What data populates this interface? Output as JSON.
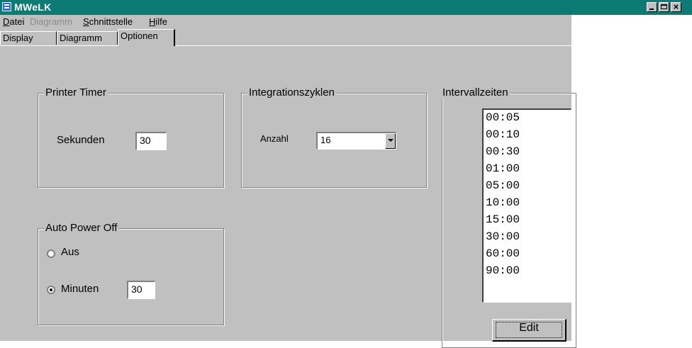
{
  "window": {
    "title": "MWeLK"
  },
  "menu": [
    {
      "label": "Datei",
      "accel": "D",
      "rest": "atei",
      "disabled": false
    },
    {
      "label": "Diagramm",
      "accel": "",
      "rest": "Diagramm",
      "disabled": true
    },
    {
      "label": "Schnittstelle",
      "accel": "S",
      "rest": "chnittstelle",
      "disabled": false
    },
    {
      "label": "Hilfe",
      "accel": "H",
      "rest": "ilfe",
      "disabled": false
    }
  ],
  "tabs": [
    {
      "label": "Display",
      "active": false
    },
    {
      "label": "Diagramm",
      "active": false
    },
    {
      "label": "Optionen",
      "active": true
    }
  ],
  "printer_timer": {
    "title": "Printer Timer",
    "label": "Sekunden",
    "value": "30"
  },
  "integration": {
    "title": "Integrationszyklen",
    "label": "Anzahl",
    "value": "16"
  },
  "auto_power_off": {
    "title": "Auto Power Off",
    "option_off": "Aus",
    "option_minutes": "Minuten",
    "selected": "Minuten",
    "minutes_value": "30"
  },
  "intervals": {
    "title": "Intervallzeiten",
    "items": [
      "00:05",
      "00:10",
      "00:30",
      "01:00",
      "05:00",
      "10:00",
      "15:00",
      "30:00",
      "60:00",
      "90:00"
    ],
    "edit_label": "Edit"
  },
  "colors": {
    "titlebar": "#0c7b73",
    "face": "#c0c0c0"
  }
}
